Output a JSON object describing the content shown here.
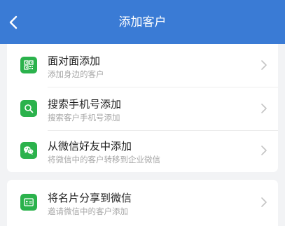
{
  "colors": {
    "header": "#3a7bd5",
    "icon_bg": "#2bb24c",
    "background": "#f2f3f5"
  },
  "header": {
    "title": "添加客户",
    "back_icon": "chevron-left-icon"
  },
  "items": [
    {
      "title": "面对面添加",
      "subtitle": "添加身边的客户",
      "icon": "qr-code-icon"
    },
    {
      "title": "搜索手机号添加",
      "subtitle": "搜索客户手机号添加",
      "icon": "search-icon"
    },
    {
      "title": "从微信好友中添加",
      "subtitle": "将微信中的客户转移到企业微信",
      "icon": "wechat-icon"
    },
    {
      "title": "将名片分享到微信",
      "subtitle": "邀请微信中的客户添加",
      "icon": "business-card-icon"
    }
  ]
}
